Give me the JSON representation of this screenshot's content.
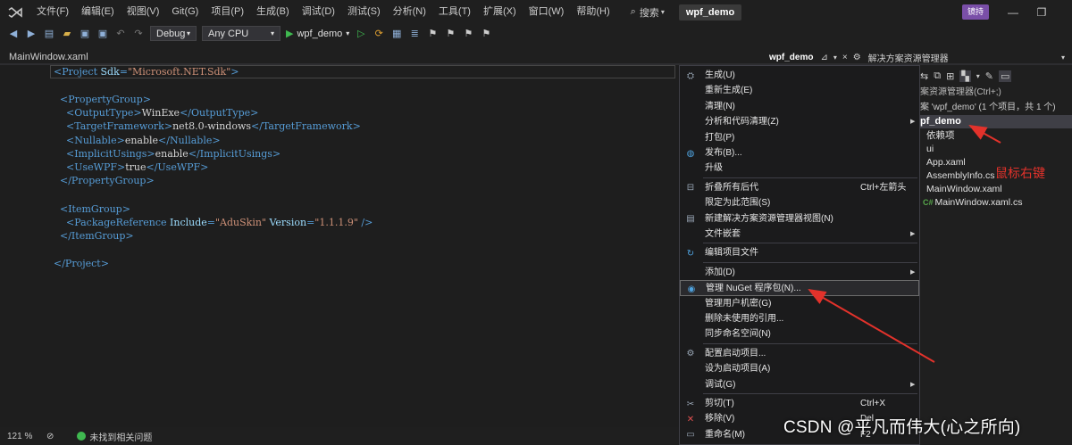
{
  "menubar": {
    "items": [
      "文件(F)",
      "编辑(E)",
      "视图(V)",
      "Git(G)",
      "项目(P)",
      "生成(B)",
      "调试(D)",
      "测试(S)",
      "分析(N)",
      "工具(T)",
      "扩展(X)",
      "窗口(W)",
      "帮助(H)"
    ],
    "search_label": "搜索",
    "solution_name": "wpf_demo",
    "user_badge": "镜持"
  },
  "toolbar": {
    "configuration": "Debug",
    "platform": "Any CPU",
    "run_target": "wpf_demo"
  },
  "editor": {
    "tab_label": "MainWindow.xaml",
    "zoom": "121 %",
    "status": "未找到相关问题"
  },
  "solution_explorer": {
    "tab_label": "wpf_demo",
    "title": "解决方案资源管理器",
    "search_placeholder": "案资源管理器(Ctrl+;)",
    "solution_line": "案 'wpf_demo' (1 个项目，共 1 个)",
    "project": "pf_demo",
    "items": [
      "依赖项",
      "ui",
      "App.xaml",
      "AssemblyInfo.cs",
      "MainWindow.xaml",
      "MainWindow.xaml.cs"
    ],
    "cs_badge": "C#"
  },
  "context_menu": {
    "items": [
      {
        "label": "生成(U)",
        "shortcut": "",
        "submenu": false,
        "icon": "build-icon"
      },
      {
        "label": "重新生成(E)",
        "shortcut": "",
        "submenu": false,
        "icon": ""
      },
      {
        "label": "清理(N)",
        "shortcut": "",
        "submenu": false,
        "icon": ""
      },
      {
        "label": "分析和代码清理(Z)",
        "shortcut": "",
        "submenu": true,
        "icon": ""
      },
      {
        "label": "打包(P)",
        "shortcut": "",
        "submenu": false,
        "icon": ""
      },
      {
        "label": "发布(B)...",
        "shortcut": "",
        "submenu": false,
        "icon": "globe-icon"
      },
      {
        "label": "升级",
        "shortcut": "",
        "submenu": false,
        "icon": ""
      },
      {
        "label": "折叠所有后代",
        "shortcut": "Ctrl+左箭头",
        "submenu": false,
        "icon": "collapse-icon"
      },
      {
        "label": "限定为此范围(S)",
        "shortcut": "",
        "submenu": false,
        "icon": ""
      },
      {
        "label": "新建解决方案资源管理器视图(N)",
        "shortcut": "",
        "submenu": false,
        "icon": "new-view-icon"
      },
      {
        "label": "文件嵌套",
        "shortcut": "",
        "submenu": true,
        "icon": ""
      },
      {
        "label": "编辑项目文件",
        "shortcut": "",
        "submenu": false,
        "icon": "edit-file-icon"
      },
      {
        "label": "添加(D)",
        "shortcut": "",
        "submenu": true,
        "icon": ""
      },
      {
        "label": "管理 NuGet 程序包(N)...",
        "shortcut": "",
        "submenu": false,
        "icon": "nuget-icon"
      },
      {
        "label": "管理用户机密(G)",
        "shortcut": "",
        "submenu": false,
        "icon": ""
      },
      {
        "label": "删除未使用的引用...",
        "shortcut": "",
        "submenu": false,
        "icon": ""
      },
      {
        "label": "同步命名空间(N)",
        "shortcut": "",
        "submenu": false,
        "icon": ""
      },
      {
        "label": "配置启动项目...",
        "shortcut": "",
        "submenu": false,
        "icon": "gear-icon"
      },
      {
        "label": "设为启动项目(A)",
        "shortcut": "",
        "submenu": false,
        "icon": ""
      },
      {
        "label": "调试(G)",
        "shortcut": "",
        "submenu": true,
        "icon": ""
      },
      {
        "label": "剪切(T)",
        "shortcut": "Ctrl+X",
        "submenu": false,
        "icon": "scissors-icon"
      },
      {
        "label": "移除(V)",
        "shortcut": "Del",
        "submenu": false,
        "icon": "remove-icon"
      },
      {
        "label": "重命名(M)",
        "shortcut": "F2",
        "submenu": false,
        "icon": "rename-icon"
      }
    ]
  },
  "annotation": {
    "label": "鼠标右键",
    "color": "#e3322b"
  },
  "watermark": "CSDN @平凡而伟大(心之所向)"
}
